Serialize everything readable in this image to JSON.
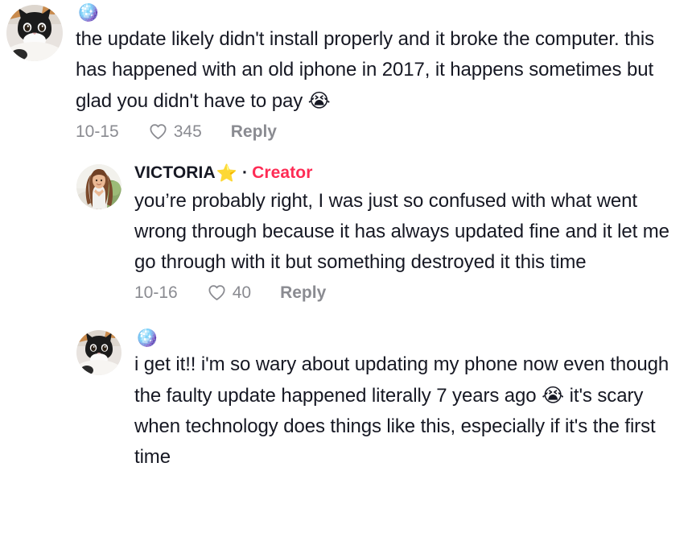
{
  "app": {
    "surface": "tiktok-comment-thread",
    "background_color": "#ffffff",
    "text_color": "#161823",
    "muted_color": "#8a8b91",
    "accent_color": "#fe2c55"
  },
  "comments": [
    {
      "id": "comment-1",
      "level": "root",
      "avatar_name": "avatar-cat",
      "username": "",
      "username_emoji": "🪩",
      "is_creator": false,
      "creator_label": "",
      "separator": "·",
      "text": "the update likely didn't install properly and it broke the computer. this has happened with an old iphone in 2017, it happens sometimes but glad you didn't have to pay ",
      "text_emoji": "😭",
      "date": "10-15",
      "likes": "345",
      "reply_label": "Reply"
    },
    {
      "id": "comment-2",
      "level": "reply",
      "avatar_name": "avatar-victoria",
      "username": "VICTORIA",
      "username_emoji": "⭐",
      "is_creator": true,
      "creator_label": "Creator",
      "separator": "·",
      "text": "you’re probably right, I was just so confused with what went wrong through because it has always updated fine and it let me go through with it but something destroyed it this time",
      "text_emoji": "",
      "date": "10-16",
      "likes": "40",
      "reply_label": "Reply"
    },
    {
      "id": "comment-3",
      "level": "reply",
      "avatar_name": "avatar-cat",
      "username": "",
      "username_emoji": "🪩",
      "is_creator": false,
      "creator_label": "",
      "separator": "·",
      "text_part1": "i get it!! i'm so wary about updating my phone now even though the faulty update happened literally 7 years ago ",
      "text_emoji": "😭",
      "text_part2": " it's scary when technology does things like this, especially if it's the first time",
      "date": "",
      "likes": "",
      "reply_label": ""
    }
  ],
  "icons": {
    "heart": "heart-icon",
    "disco_ball": "disco-ball-emoji",
    "star": "star-emoji",
    "crying": "loudly-crying-face-emoji"
  }
}
